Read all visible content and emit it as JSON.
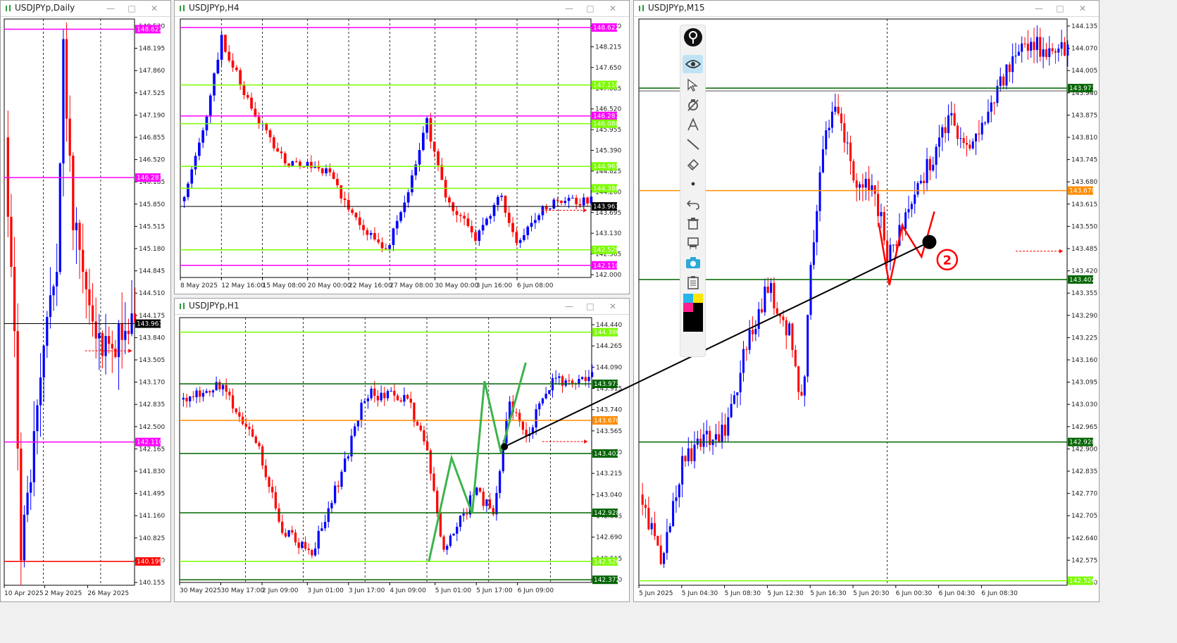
{
  "symbol": "USDJPYp",
  "windows": {
    "daily": {
      "title": "USDJPYp,Daily",
      "price_labels": [
        "148.530",
        "148.195",
        "147.860",
        "147.525",
        "147.190",
        "146.855",
        "146.520",
        "146.185",
        "145.850",
        "145.515",
        "145.180",
        "144.845",
        "144.510",
        "144.175",
        "143.840",
        "143.505",
        "143.170",
        "142.835",
        "142.500",
        "142.165",
        "141.830",
        "141.495",
        "141.160",
        "140.825",
        "140.490",
        "140.155"
      ],
      "time_labels": [
        "10 Apr 2025",
        "2 May 2025",
        "26 May 2025"
      ],
      "level_tags": [
        {
          "text": "148.622",
          "color": "#ff00ff"
        },
        {
          "text": "146.281",
          "color": "#ff00ff"
        },
        {
          "text": "143.963",
          "color": "#000000"
        },
        {
          "text": "142.110",
          "color": "#ff00ff"
        },
        {
          "text": "140.199",
          "color": "#ff0000"
        }
      ]
    },
    "h4": {
      "title": "USDJPYp,H4",
      "price_labels": [
        "148.780",
        "148.215",
        "147.650",
        "147.085",
        "146.520",
        "145.955",
        "145.390",
        "144.825",
        "144.260",
        "143.695",
        "143.130",
        "142.565",
        "142.000"
      ],
      "time_labels": [
        "8 May 2025",
        "12 May 16:00",
        "15 May 08:00",
        "20 May 00:00",
        "22 May 16:00",
        "27 May 08:00",
        "30 May 00:00",
        "3 Jun 16:00",
        "6 Jun 08:00"
      ],
      "level_tags": [
        {
          "text": "148.622",
          "color": "#ff00ff"
        },
        {
          "text": "147.116",
          "color": "#7cfc00"
        },
        {
          "text": "146.281",
          "color": "#ff00ff"
        },
        {
          "text": "146.088",
          "color": "#7cfc00"
        },
        {
          "text": "144.965",
          "color": "#7cfc00"
        },
        {
          "text": "144.386",
          "color": "#7cfc00"
        },
        {
          "text": "143.963",
          "color": "#000000"
        },
        {
          "text": "142.526",
          "color": "#7cfc00"
        },
        {
          "text": "142.110",
          "color": "#ff00ff"
        }
      ]
    },
    "h1": {
      "title": "USDJPYp,H1",
      "price_labels": [
        "144.440",
        "144.265",
        "144.090",
        "143.915",
        "143.740",
        "143.565",
        "143.390",
        "143.215",
        "143.040",
        "142.865",
        "142.690",
        "142.515",
        "142.340"
      ],
      "time_labels": [
        "30 May 2025",
        "30 May 17:00",
        "2 Jun 09:00",
        "3 Jun 01:00",
        "3 Jun 17:00",
        "4 Jun 09:00",
        "5 Jun 01:00",
        "5 Jun 17:00",
        "6 Jun 09:00"
      ],
      "level_tags": [
        {
          "text": "144.386",
          "color": "#7cfc00"
        },
        {
          "text": "143.973",
          "color": "#006400"
        },
        {
          "text": "143.670",
          "color": "#ff8c00"
        },
        {
          "text": "143.402",
          "color": "#006400"
        },
        {
          "text": "142.928",
          "color": "#006400"
        },
        {
          "text": "142.526",
          "color": "#7cfc00"
        },
        {
          "text": "142.372",
          "color": "#006400"
        }
      ]
    },
    "m15": {
      "title": "USDJPYp,M15",
      "price_labels": [
        "144.135",
        "144.070",
        "144.005",
        "143.940",
        "143.875",
        "143.810",
        "143.745",
        "143.680",
        "143.615",
        "143.550",
        "143.485",
        "143.420",
        "143.355",
        "143.290",
        "143.225",
        "143.160",
        "143.095",
        "143.030",
        "142.965",
        "142.900",
        "142.835",
        "142.770",
        "142.705",
        "142.640",
        "142.575",
        "142.510"
      ],
      "time_labels": [
        "5 Jun 2025",
        "5 Jun 04:30",
        "5 Jun 08:30",
        "5 Jun 12:30",
        "5 Jun 16:30",
        "5 Jun 20:30",
        "6 Jun 00:30",
        "6 Jun 04:30",
        "6 Jun 08:30"
      ],
      "level_tags": [
        {
          "text": "143.973",
          "color": "#006400"
        },
        {
          "text": "143.670",
          "color": "#ff8c00"
        },
        {
          "text": "143.402",
          "color": "#006400"
        },
        {
          "text": "142.928",
          "color": "#006400"
        },
        {
          "text": "142.526",
          "color": "#7cfc00"
        }
      ],
      "annotation_number": "②"
    }
  },
  "toolbar": {
    "tools": [
      "pin-icon",
      "eye-icon",
      "cursor-icon",
      "magnet-icon",
      "text-icon",
      "line-icon",
      "eraser-icon",
      "dot-icon",
      "undo-icon",
      "trash-icon",
      "stamp-icon",
      "camera-icon",
      "clipboard-icon",
      "palette-icon"
    ]
  },
  "window_buttons": {
    "minimize": "—",
    "maximize": "□",
    "close": "✕"
  }
}
